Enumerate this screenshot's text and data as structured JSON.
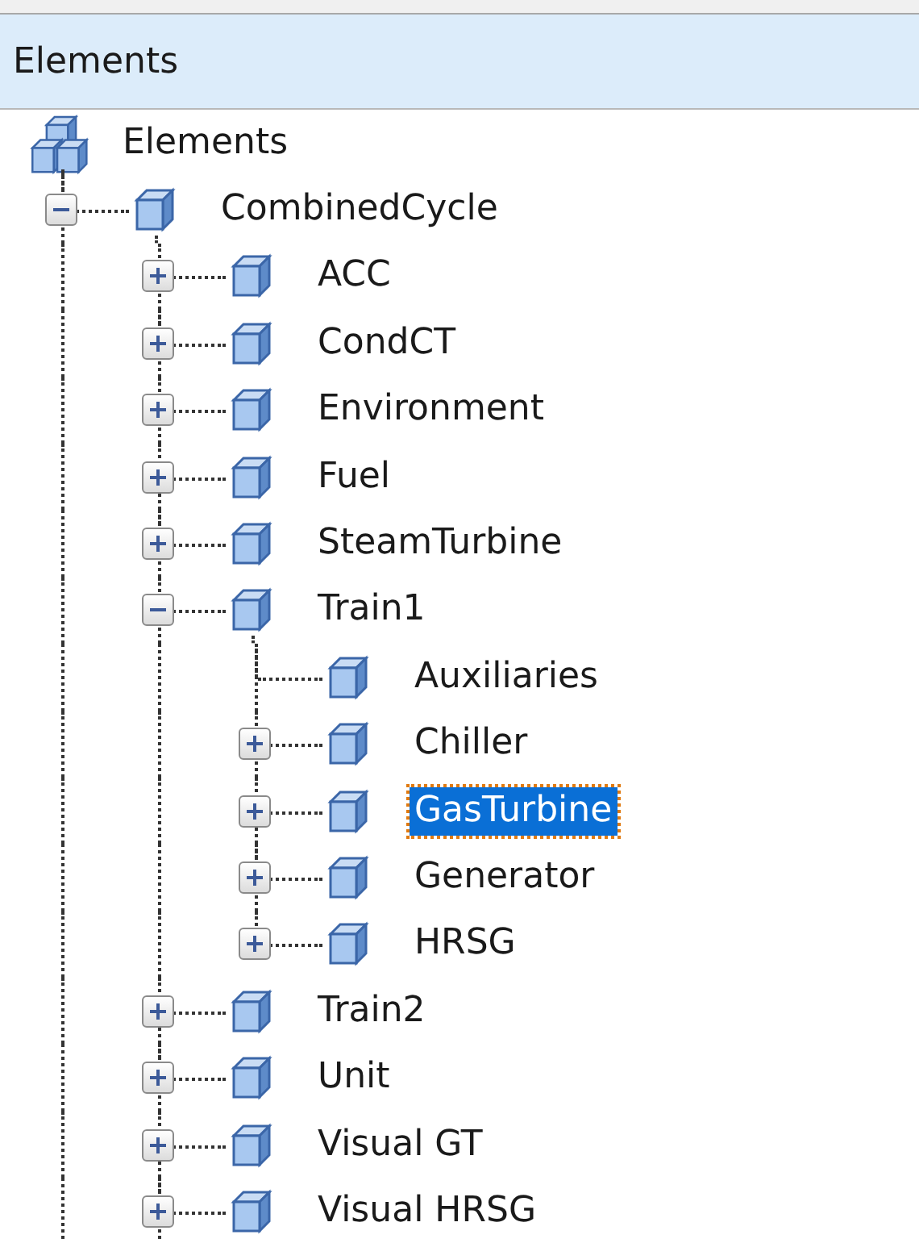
{
  "panel": {
    "title": "Elements"
  },
  "tree": [
    {
      "label": "Elements",
      "kind": "root",
      "selected": false,
      "expanded": true,
      "children": [
        {
          "label": "CombinedCycle",
          "kind": "branch",
          "selected": false,
          "expanded": true,
          "children": [
            {
              "label": "ACC",
              "kind": "branch",
              "selected": false,
              "expanded": false
            },
            {
              "label": "CondCT",
              "kind": "branch",
              "selected": false,
              "expanded": false
            },
            {
              "label": "Environment",
              "kind": "branch",
              "selected": false,
              "expanded": false
            },
            {
              "label": "Fuel",
              "kind": "branch",
              "selected": false,
              "expanded": false
            },
            {
              "label": "SteamTurbine",
              "kind": "branch",
              "selected": false,
              "expanded": false
            },
            {
              "label": "Train1",
              "kind": "branch",
              "selected": false,
              "expanded": true,
              "children": [
                {
                  "label": "Auxiliaries",
                  "kind": "leaf",
                  "selected": false
                },
                {
                  "label": "Chiller",
                  "kind": "branch",
                  "selected": false,
                  "expanded": false
                },
                {
                  "label": "GasTurbine",
                  "kind": "branch",
                  "selected": true,
                  "expanded": false
                },
                {
                  "label": "Generator",
                  "kind": "branch",
                  "selected": false,
                  "expanded": false
                },
                {
                  "label": "HRSG",
                  "kind": "branch",
                  "selected": false,
                  "expanded": false
                }
              ]
            },
            {
              "label": "Train2",
              "kind": "branch",
              "selected": false,
              "expanded": false
            },
            {
              "label": "Unit",
              "kind": "branch",
              "selected": false,
              "expanded": false
            },
            {
              "label": "Visual GT",
              "kind": "branch",
              "selected": false,
              "expanded": false
            },
            {
              "label": "Visual HRSG",
              "kind": "branch",
              "selected": false,
              "expanded": false
            }
          ]
        }
      ]
    }
  ]
}
